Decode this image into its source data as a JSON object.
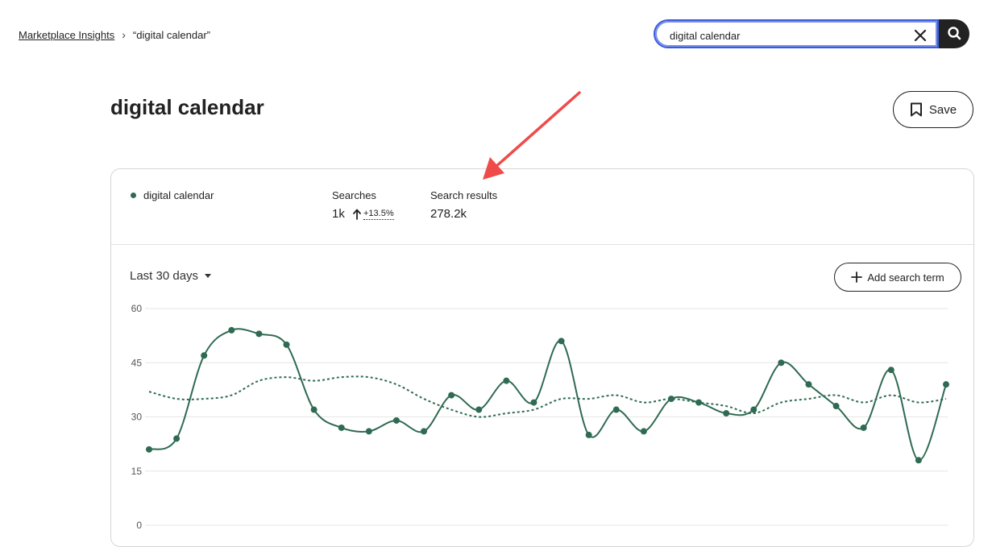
{
  "breadcrumb": {
    "parent": "Marketplace Insights",
    "separator": "›",
    "current": "“digital calendar”"
  },
  "search": {
    "value": "digital calendar",
    "clear_icon": "close-icon",
    "submit_icon": "search-icon"
  },
  "page": {
    "title": "digital calendar",
    "save_label": "Save",
    "save_icon": "bookmark-icon"
  },
  "summary": {
    "term": "digital calendar",
    "searches_label": "Searches",
    "searches_value": "1k",
    "searches_trend": "+13.5%",
    "trend_icon": "arrow-up-icon",
    "results_label": "Search results",
    "results_value": "278.2k"
  },
  "controls": {
    "range_label": "Last 30 days",
    "add_term_label": "Add search term"
  },
  "colors": {
    "series": "#2f6a52",
    "annotation_arrow": "#ef4b4b"
  },
  "chart_data": {
    "type": "line",
    "ylim": [
      0,
      60
    ],
    "yticks": [
      "60",
      "45",
      "30",
      "15",
      "0"
    ],
    "grid": true,
    "series": [
      {
        "name": "digital calendar",
        "style": "solid with markers",
        "values": [
          21,
          24,
          47,
          54,
          53,
          50,
          32,
          27,
          26,
          29,
          26,
          36,
          32,
          40,
          34,
          51,
          25,
          32,
          26,
          35,
          34,
          31,
          32,
          45,
          39,
          33,
          27,
          43,
          18,
          39
        ]
      },
      {
        "style": "dotted",
        "values": [
          37,
          35,
          35,
          36,
          40,
          41,
          40,
          41,
          41,
          39,
          35,
          32,
          30,
          31,
          32,
          35,
          35,
          36,
          34,
          35,
          34,
          33,
          31,
          34,
          35,
          36,
          34,
          36,
          34,
          35
        ]
      }
    ]
  }
}
